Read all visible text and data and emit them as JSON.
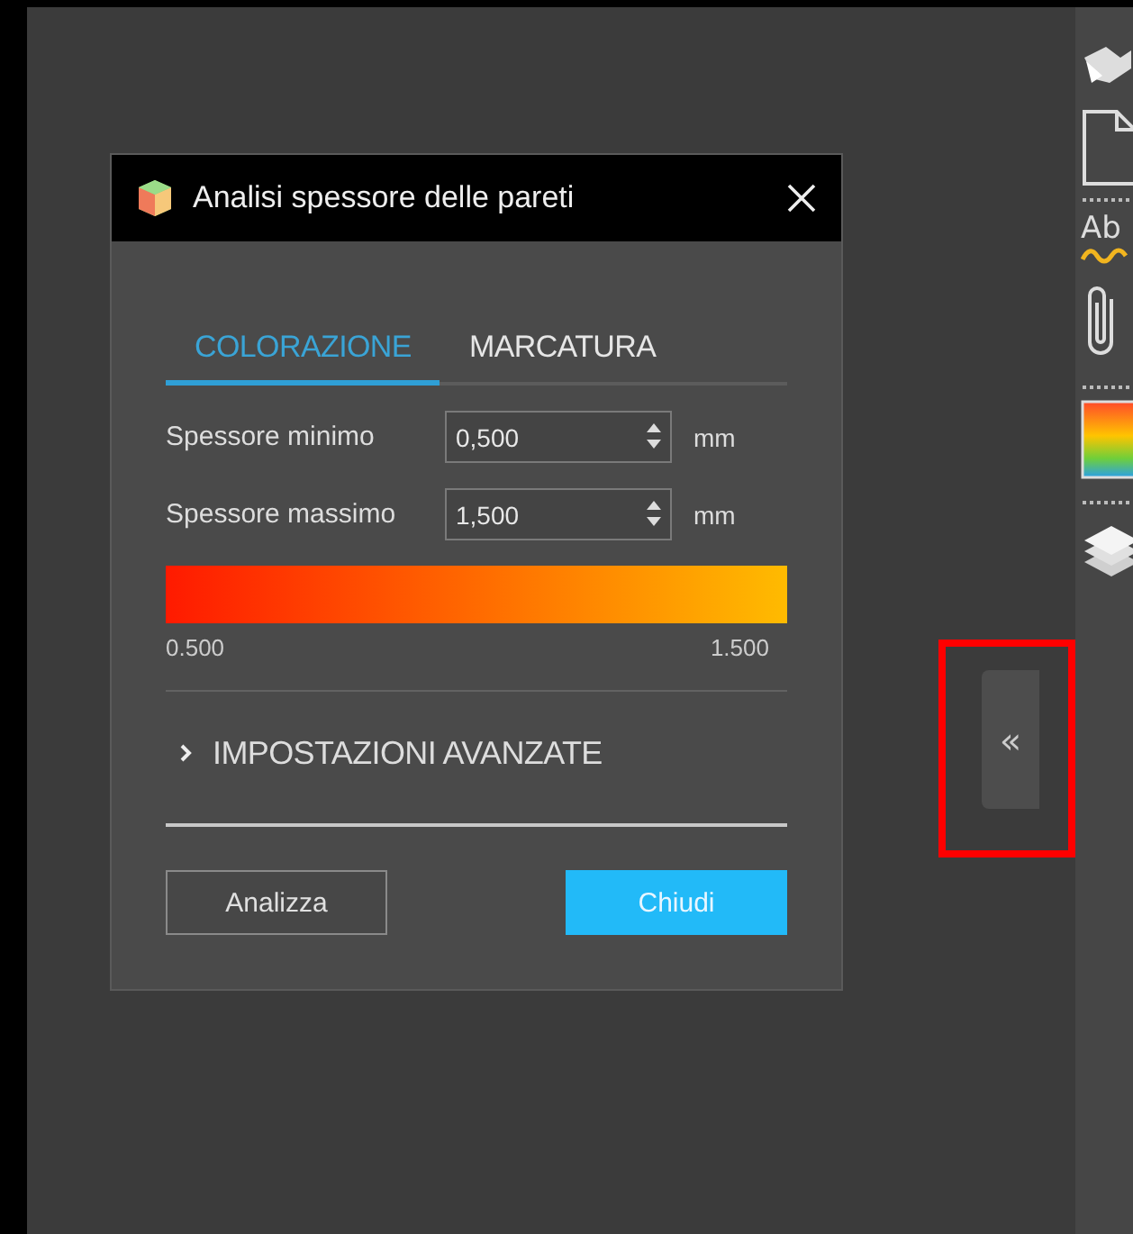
{
  "dialog": {
    "title": "Analisi spessore delle pareti",
    "tabs": [
      {
        "label": "COLORAZIONE",
        "selected": true
      },
      {
        "label": "MARCATURA",
        "selected": false
      }
    ],
    "fields": [
      {
        "label": "Spessore minimo",
        "value": "0,500",
        "unit": "mm"
      },
      {
        "label": "Spessore massimo",
        "value": "1,500",
        "unit": "mm"
      }
    ],
    "color_scale": {
      "min_label": "0.500",
      "max_label": "1.500"
    },
    "advanced": {
      "label": "IMPOSTAZIONI AVANZATE",
      "expanded": false
    },
    "buttons": [
      {
        "label": "Analizza",
        "kind": "secondary"
      },
      {
        "label": "Chiudi",
        "kind": "primary"
      }
    ]
  },
  "toolbar": {
    "spellcheck_text": "Ab"
  },
  "collapse_button": {
    "label": "«",
    "highlighted": true
  }
}
